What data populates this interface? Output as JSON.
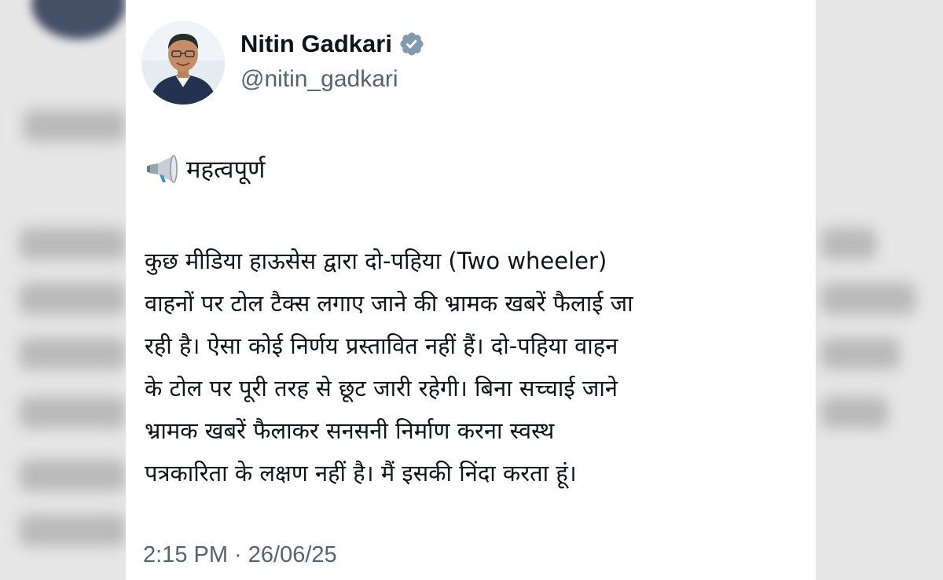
{
  "tweet": {
    "display_name": "Nitin Gadkari",
    "handle": "@nitin_gadkari",
    "verified_icon": "verified-badge-icon",
    "heading_icon": "megaphone-icon",
    "heading": "महत्वपूर्ण",
    "body_lines": [
      "कुछ मीडिया हाऊसेस  द्वारा दो-पहिया (Two wheeler)",
      "वाहनों पर टोल टैक्स लगाए जाने की भ्रामक खबरें फैलाई जा",
      "रही है। ऐसा कोई निर्णय प्रस्तावित नहीं हैं। दो-पहिया वाहन",
      "के टोल पर पूरी तरह से छूट जारी रहेगी। बिना सच्चाई जाने",
      "भ्रामक खबरें फैलाकर सनसनी निर्माण करना स्वस्थ",
      "पत्रकारिता के लक्षण नहीं है। मैं इसकी निंदा करता हूं।"
    ],
    "timestamp": "2:15 PM · 26/06/25"
  },
  "colors": {
    "name": "#0f1419",
    "secondary": "#536471",
    "verified": "#829aab",
    "card": "#ffffff",
    "background": "#e6e6e6"
  }
}
